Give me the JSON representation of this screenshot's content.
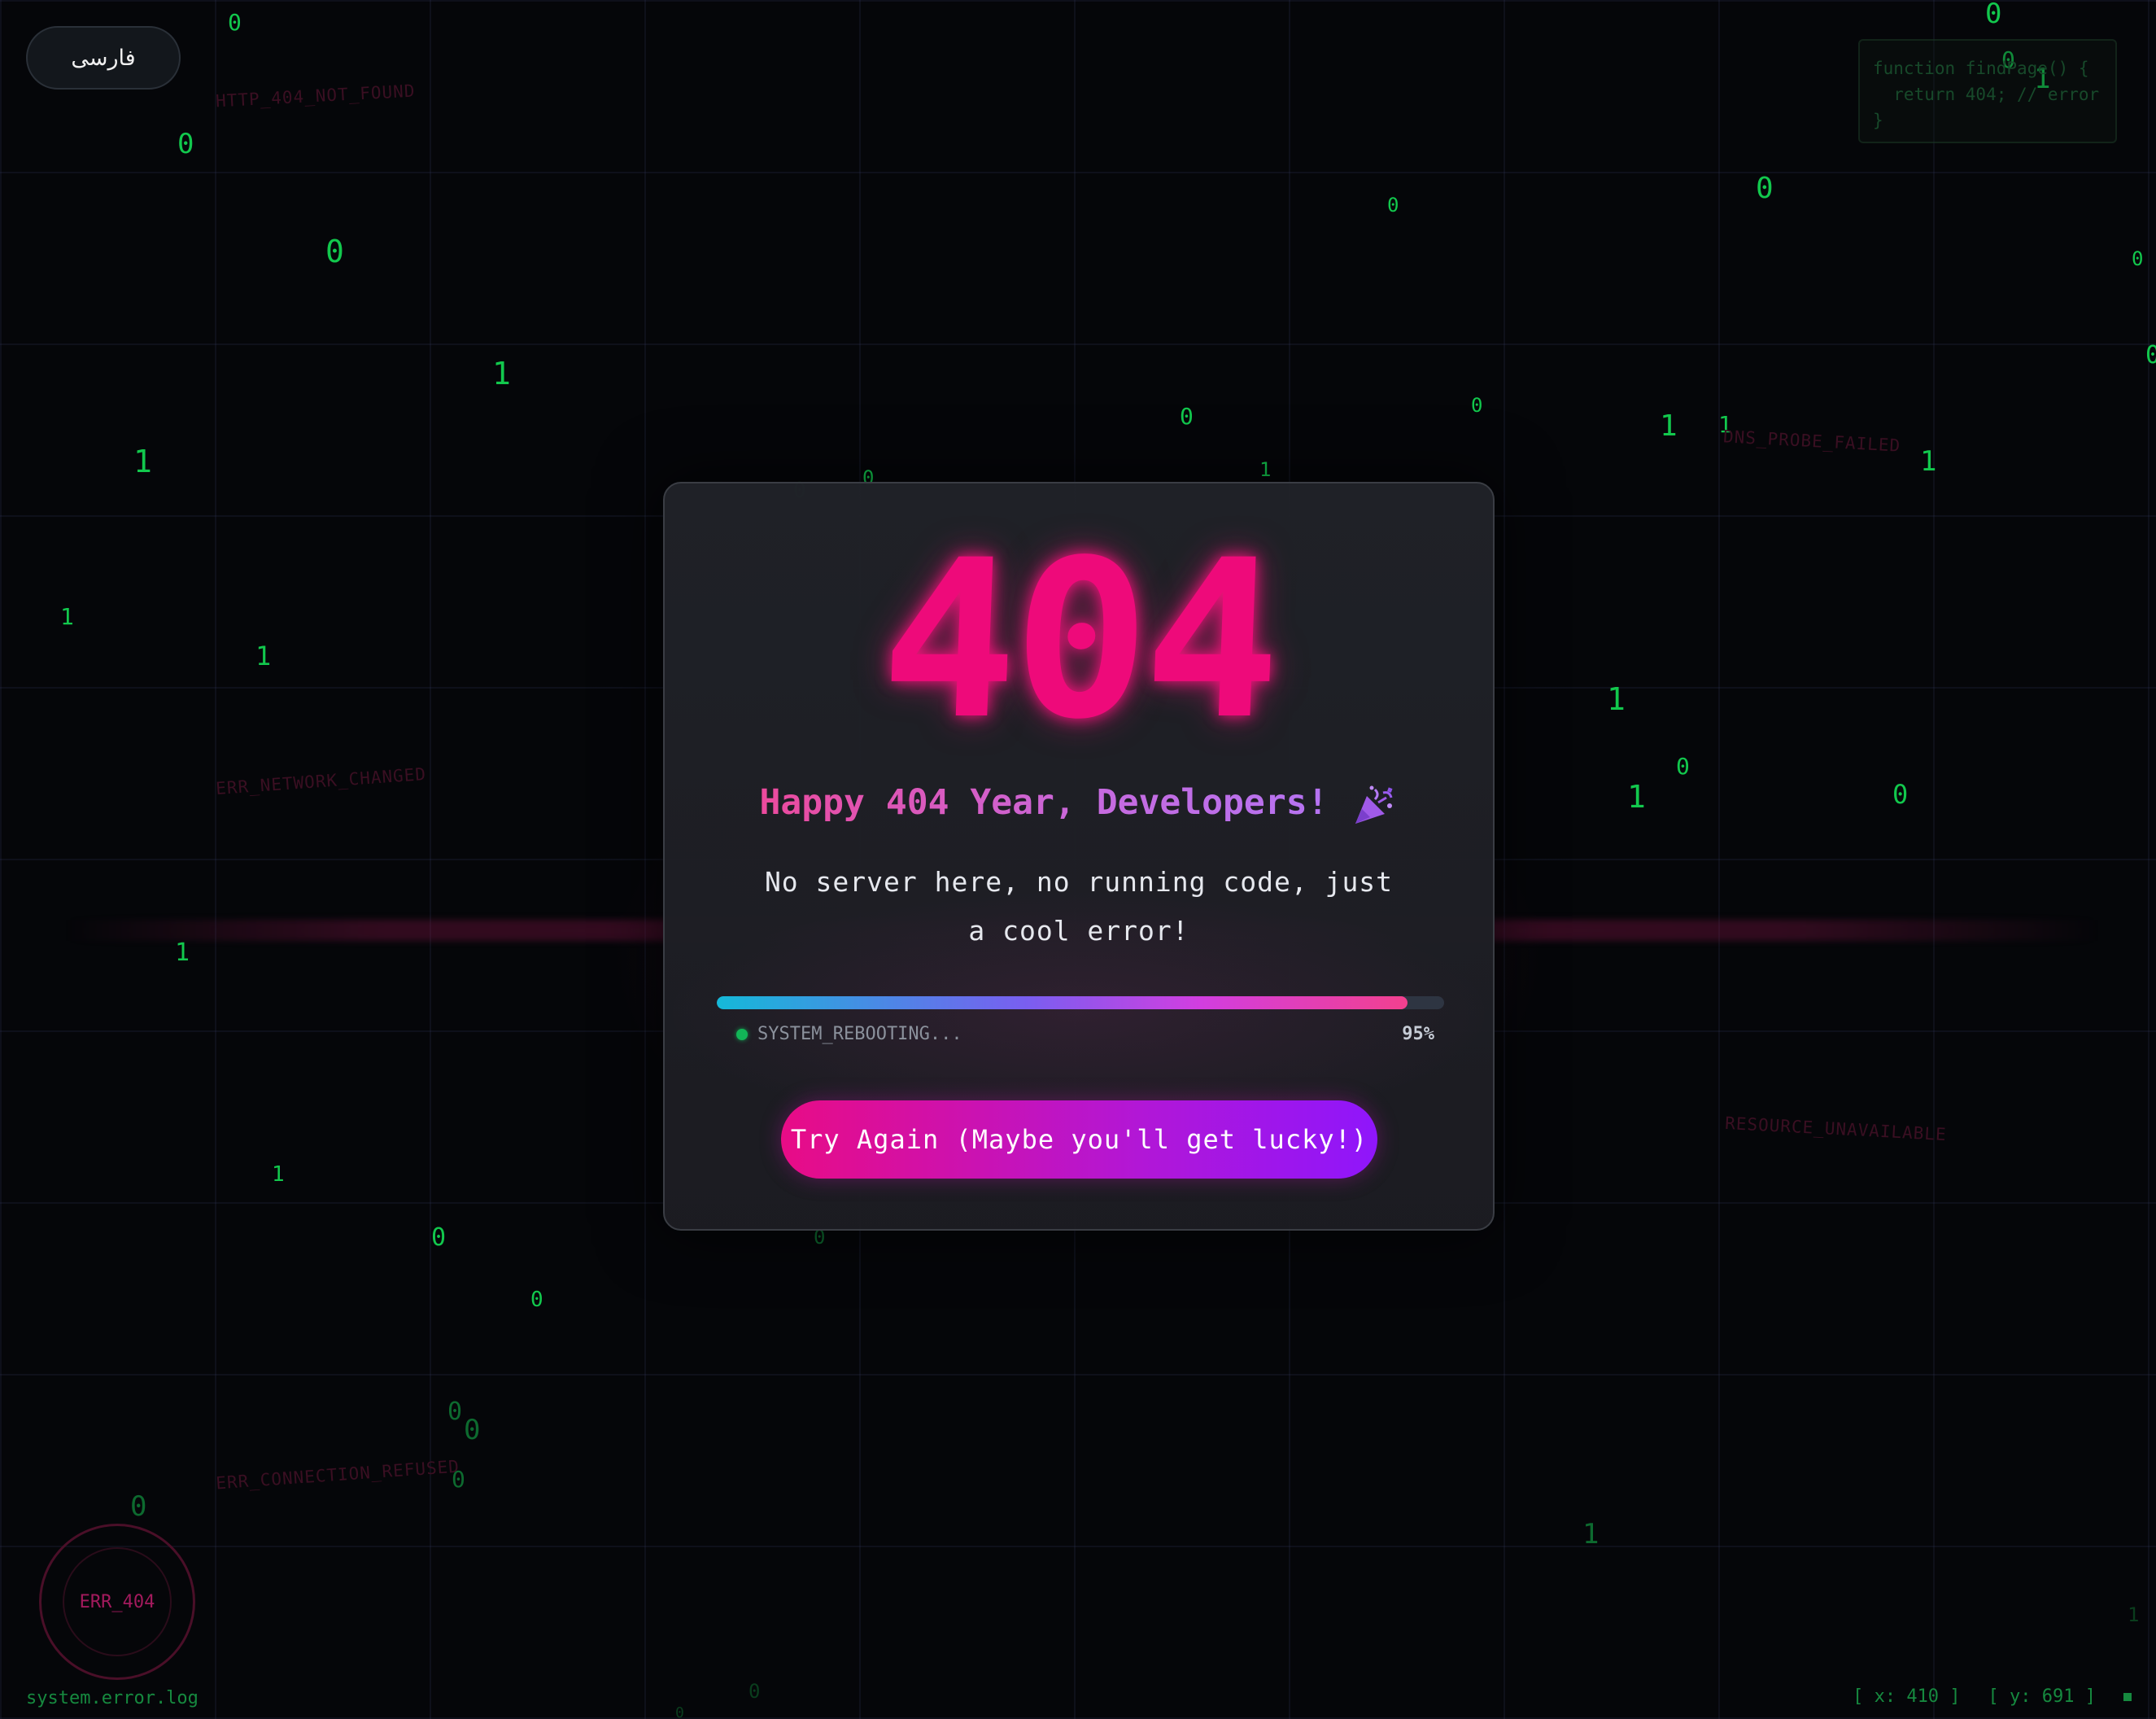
{
  "lang_button": {
    "label": "فارسی"
  },
  "code_snippet": {
    "lines": [
      "function findPage() {",
      "  return 404; // error",
      "}"
    ]
  },
  "error_codes": [
    "HTTP_404_NOT_FOUND",
    "ERR_NETWORK_CHANGED",
    "ERR_CONNECTION_REFUSED",
    "DNS_PROBE_FAILED",
    "RESOURCE_UNAVAILABLE"
  ],
  "card": {
    "code": "404",
    "headline": "Happy 404 Year, Developers!",
    "headline_icon": "party-popper-icon",
    "message": "No server here, no running code, just a cool error!",
    "progress": {
      "percent": 95,
      "status": "SYSTEM_REBOOTING...",
      "percent_label": "95%"
    },
    "button_label": "Try Again (Maybe you'll get lucky!)"
  },
  "badge": {
    "label": "ERR_404"
  },
  "footer": {
    "log_label": "system.error.log",
    "x_label": "[ x: 410 ]",
    "y_label": "[ y: 691 ]"
  },
  "colors": {
    "accent_pink": "#ee0a7a",
    "accent_purple": "#8f16fb",
    "matrix_green": "#12c84d",
    "background": "#050609"
  }
}
